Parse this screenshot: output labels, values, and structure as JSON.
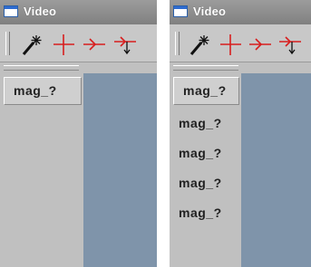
{
  "panels": [
    {
      "window": {
        "title": "Video"
      },
      "list_items": [
        "mag_?"
      ]
    },
    {
      "window": {
        "title": "Video"
      },
      "list_items": [
        "mag_?",
        "mag_?",
        "mag_?",
        "mag_?",
        "mag_?"
      ]
    }
  ],
  "toolbar": {
    "tools": [
      "magic-wand-icon",
      "crosshair-icon",
      "arrow-join-icon",
      "arrow-branch-icon"
    ]
  },
  "colors": {
    "titlebar": "#8c8c8c",
    "panel": "#c0c0c0",
    "view_area": "#7f94aa",
    "tool_red": "#d81e1e"
  }
}
